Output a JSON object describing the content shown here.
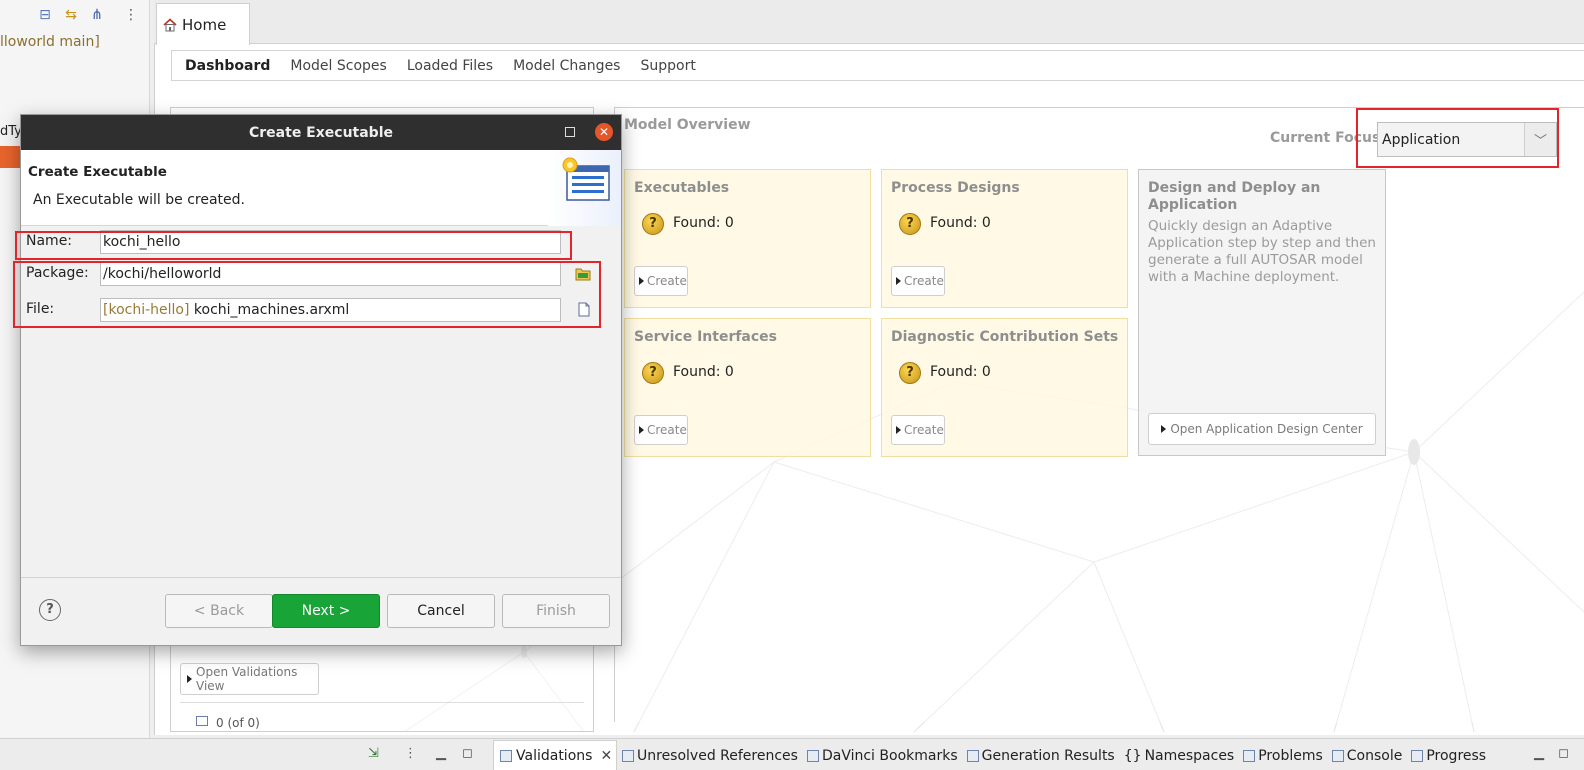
{
  "explorer": {
    "project_label": "lloworld main]",
    "column_fragment": "dTy"
  },
  "editor": {
    "tab_label": "Home",
    "subnav": [
      "Dashboard",
      "Model Scopes",
      "Loaded Files",
      "Model Changes",
      "Support"
    ],
    "validations_link": "Open Validations View",
    "scope_fragment": "0 (of 0)"
  },
  "overview": {
    "title": "Model Overview",
    "focus_label": "Current Focus:",
    "focus_value": "Application",
    "cards": [
      {
        "title": "Executables",
        "found": "Found: 0",
        "button": "Create"
      },
      {
        "title": "Process Designs",
        "found": "Found: 0",
        "button": "Create"
      },
      {
        "title": "Service Interfaces",
        "found": "Found: 0",
        "button": "Create"
      },
      {
        "title": "Diagnostic Contribution Sets",
        "found": "Found: 0",
        "button": "Create"
      }
    ],
    "deploy": {
      "title": "Design and Deploy an Application",
      "description": "Quickly design an Adaptive Application step by step and then generate a full AUTOSAR model with a Machine deployment.",
      "button": "Open Application Design Center"
    }
  },
  "dialog": {
    "title": "Create Executable",
    "header_title": "Create Executable",
    "header_desc": "An Executable will be created.",
    "fields": {
      "name_label": "Name:",
      "name_value": "kochi_hello",
      "package_label": "Package:",
      "package_value": "/kochi/helloworld",
      "file_label": "File:",
      "file_prefix": "[kochi-hello]",
      "file_value": "kochi_machines.arxml"
    },
    "buttons": {
      "help": "?",
      "back": "< Back",
      "next": "Next >",
      "cancel": "Cancel",
      "finish": "Finish"
    }
  },
  "bottom_tabs": {
    "active": "Validations",
    "others": [
      "Unresolved References",
      "DaVinci Bookmarks",
      "Generation Results",
      "Namespaces",
      "Problems",
      "Console",
      "Progress"
    ]
  },
  "colors": {
    "highlight": "#e0252b",
    "primary_button": "#18a436",
    "card_yellow": "#fff8de",
    "title_bar": "#2f2f2f"
  }
}
